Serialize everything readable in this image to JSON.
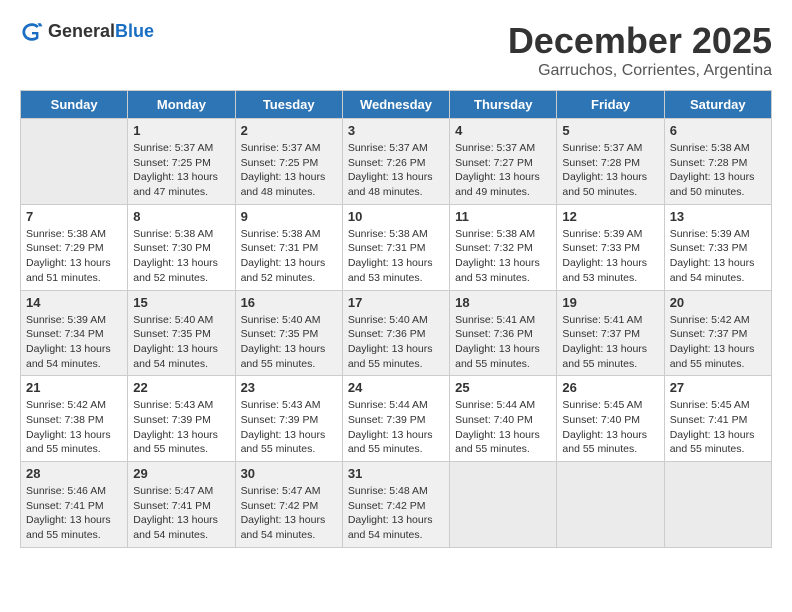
{
  "header": {
    "logo_line1": "General",
    "logo_line2": "Blue",
    "month_title": "December 2025",
    "subtitle": "Garruchos, Corrientes, Argentina"
  },
  "weekdays": [
    "Sunday",
    "Monday",
    "Tuesday",
    "Wednesday",
    "Thursday",
    "Friday",
    "Saturday"
  ],
  "weeks": [
    [
      {
        "day": "",
        "sunrise": "",
        "sunset": "",
        "daylight": ""
      },
      {
        "day": "1",
        "sunrise": "5:37 AM",
        "sunset": "7:25 PM",
        "daylight": "13 hours and 47 minutes."
      },
      {
        "day": "2",
        "sunrise": "5:37 AM",
        "sunset": "7:25 PM",
        "daylight": "13 hours and 48 minutes."
      },
      {
        "day": "3",
        "sunrise": "5:37 AM",
        "sunset": "7:26 PM",
        "daylight": "13 hours and 48 minutes."
      },
      {
        "day": "4",
        "sunrise": "5:37 AM",
        "sunset": "7:27 PM",
        "daylight": "13 hours and 49 minutes."
      },
      {
        "day": "5",
        "sunrise": "5:37 AM",
        "sunset": "7:28 PM",
        "daylight": "13 hours and 50 minutes."
      },
      {
        "day": "6",
        "sunrise": "5:38 AM",
        "sunset": "7:28 PM",
        "daylight": "13 hours and 50 minutes."
      }
    ],
    [
      {
        "day": "7",
        "sunrise": "5:38 AM",
        "sunset": "7:29 PM",
        "daylight": "13 hours and 51 minutes."
      },
      {
        "day": "8",
        "sunrise": "5:38 AM",
        "sunset": "7:30 PM",
        "daylight": "13 hours and 52 minutes."
      },
      {
        "day": "9",
        "sunrise": "5:38 AM",
        "sunset": "7:31 PM",
        "daylight": "13 hours and 52 minutes."
      },
      {
        "day": "10",
        "sunrise": "5:38 AM",
        "sunset": "7:31 PM",
        "daylight": "13 hours and 53 minutes."
      },
      {
        "day": "11",
        "sunrise": "5:38 AM",
        "sunset": "7:32 PM",
        "daylight": "13 hours and 53 minutes."
      },
      {
        "day": "12",
        "sunrise": "5:39 AM",
        "sunset": "7:33 PM",
        "daylight": "13 hours and 53 minutes."
      },
      {
        "day": "13",
        "sunrise": "5:39 AM",
        "sunset": "7:33 PM",
        "daylight": "13 hours and 54 minutes."
      }
    ],
    [
      {
        "day": "14",
        "sunrise": "5:39 AM",
        "sunset": "7:34 PM",
        "daylight": "13 hours and 54 minutes."
      },
      {
        "day": "15",
        "sunrise": "5:40 AM",
        "sunset": "7:35 PM",
        "daylight": "13 hours and 54 minutes."
      },
      {
        "day": "16",
        "sunrise": "5:40 AM",
        "sunset": "7:35 PM",
        "daylight": "13 hours and 55 minutes."
      },
      {
        "day": "17",
        "sunrise": "5:40 AM",
        "sunset": "7:36 PM",
        "daylight": "13 hours and 55 minutes."
      },
      {
        "day": "18",
        "sunrise": "5:41 AM",
        "sunset": "7:36 PM",
        "daylight": "13 hours and 55 minutes."
      },
      {
        "day": "19",
        "sunrise": "5:41 AM",
        "sunset": "7:37 PM",
        "daylight": "13 hours and 55 minutes."
      },
      {
        "day": "20",
        "sunrise": "5:42 AM",
        "sunset": "7:37 PM",
        "daylight": "13 hours and 55 minutes."
      }
    ],
    [
      {
        "day": "21",
        "sunrise": "5:42 AM",
        "sunset": "7:38 PM",
        "daylight": "13 hours and 55 minutes."
      },
      {
        "day": "22",
        "sunrise": "5:43 AM",
        "sunset": "7:39 PM",
        "daylight": "13 hours and 55 minutes."
      },
      {
        "day": "23",
        "sunrise": "5:43 AM",
        "sunset": "7:39 PM",
        "daylight": "13 hours and 55 minutes."
      },
      {
        "day": "24",
        "sunrise": "5:44 AM",
        "sunset": "7:39 PM",
        "daylight": "13 hours and 55 minutes."
      },
      {
        "day": "25",
        "sunrise": "5:44 AM",
        "sunset": "7:40 PM",
        "daylight": "13 hours and 55 minutes."
      },
      {
        "day": "26",
        "sunrise": "5:45 AM",
        "sunset": "7:40 PM",
        "daylight": "13 hours and 55 minutes."
      },
      {
        "day": "27",
        "sunrise": "5:45 AM",
        "sunset": "7:41 PM",
        "daylight": "13 hours and 55 minutes."
      }
    ],
    [
      {
        "day": "28",
        "sunrise": "5:46 AM",
        "sunset": "7:41 PM",
        "daylight": "13 hours and 55 minutes."
      },
      {
        "day": "29",
        "sunrise": "5:47 AM",
        "sunset": "7:41 PM",
        "daylight": "13 hours and 54 minutes."
      },
      {
        "day": "30",
        "sunrise": "5:47 AM",
        "sunset": "7:42 PM",
        "daylight": "13 hours and 54 minutes."
      },
      {
        "day": "31",
        "sunrise": "5:48 AM",
        "sunset": "7:42 PM",
        "daylight": "13 hours and 54 minutes."
      },
      {
        "day": "",
        "sunrise": "",
        "sunset": "",
        "daylight": ""
      },
      {
        "day": "",
        "sunrise": "",
        "sunset": "",
        "daylight": ""
      },
      {
        "day": "",
        "sunrise": "",
        "sunset": "",
        "daylight": ""
      }
    ]
  ]
}
